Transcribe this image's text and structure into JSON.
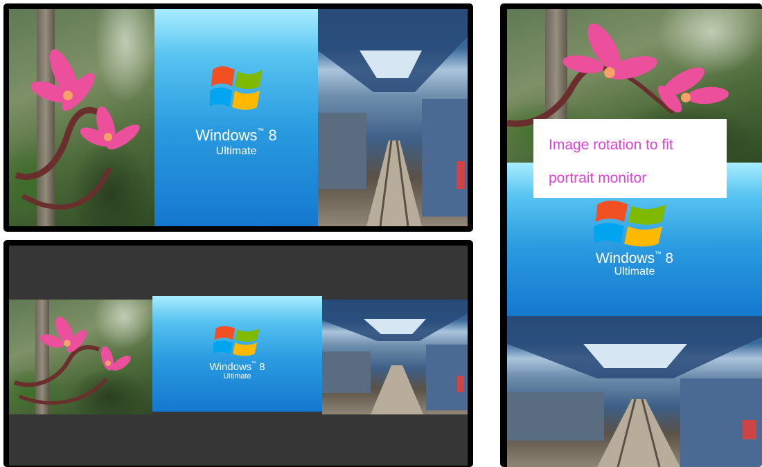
{
  "caption": {
    "line1": "Image rotation to fit",
    "line2": "portrait monitor",
    "color": "#e23fd5"
  },
  "windows_logo": {
    "brand": "Windows",
    "version": "8",
    "edition": "Ultimate"
  },
  "panels": [
    {
      "name": "landscape-fill",
      "tiles": [
        "flower",
        "windows",
        "train"
      ]
    },
    {
      "name": "landscape-letterbox",
      "tiles": [
        "flower",
        "windows",
        "train"
      ]
    },
    {
      "name": "portrait-rotated",
      "tiles": [
        "flower",
        "windows",
        "train"
      ]
    }
  ],
  "colors": {
    "bezel": "#000000",
    "letterbox": "#363636",
    "windows_blue": "#2a9be0"
  }
}
